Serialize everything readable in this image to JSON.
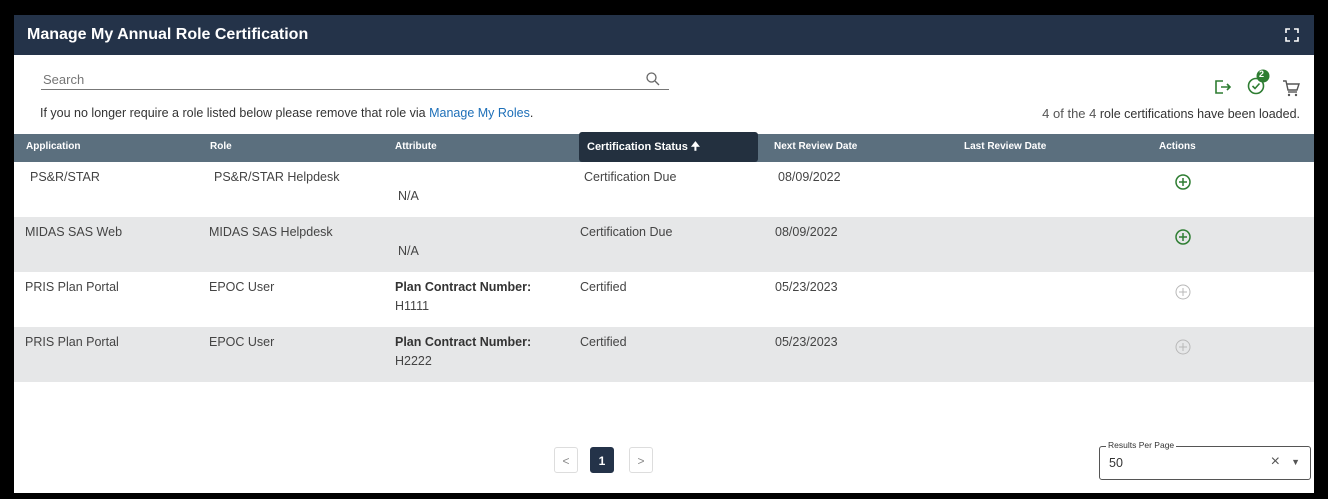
{
  "header": {
    "title": "Manage My Annual Role Certification"
  },
  "search": {
    "placeholder": "Search"
  },
  "info": {
    "text": "If you no longer require a role listed below please remove that role via ",
    "link": "Manage My Roles",
    "tail": "."
  },
  "count": {
    "prefix": "4 of the 4",
    "suffix": " role certifications have been loaded."
  },
  "badge": "2",
  "columns": [
    "Application",
    "Role",
    "Attribute",
    "Certification Status",
    "Next Review Date",
    "Last Review Date",
    "Actions"
  ],
  "rows": [
    {
      "application": "PS&R/STAR",
      "role": "PS&R/STAR Helpdesk",
      "attr_label": "",
      "attr_value": "N/A",
      "status": "Certification Due",
      "next": "08/09/2022",
      "last": ""
    },
    {
      "application": "MIDAS SAS Web",
      "role": "MIDAS SAS Helpdesk",
      "attr_label": "",
      "attr_value": "N/A",
      "status": "Certification Due",
      "next": "08/09/2022",
      "last": ""
    },
    {
      "application": "PRIS Plan Portal",
      "role": "EPOC User",
      "attr_label": "Plan Contract Number:",
      "attr_value": "H1111",
      "status": "Certified",
      "next": "05/23/2023",
      "last": ""
    },
    {
      "application": "PRIS Plan Portal",
      "role": "EPOC User",
      "attr_label": "Plan Contract Number:",
      "attr_value": "H2222",
      "status": "Certified",
      "next": "05/23/2023",
      "last": ""
    }
  ],
  "pager": {
    "prev": "<",
    "current": "1",
    "next": ">"
  },
  "results_per_page": {
    "label": "Results Per Page",
    "value": "50"
  },
  "colors": {
    "header": "#243349",
    "table_header": "#5b6f7e",
    "action_active": "#2e7d32",
    "action_disabled": "#b8b8b8"
  }
}
